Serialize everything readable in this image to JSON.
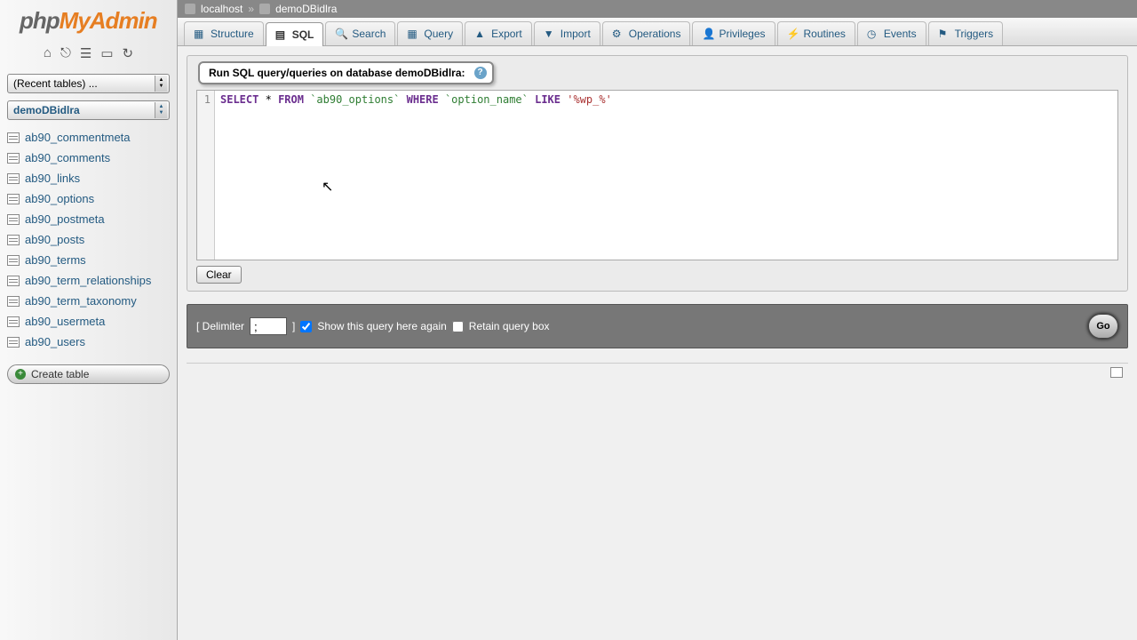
{
  "logo": {
    "part1": "php",
    "part2": "MyAdmin"
  },
  "breadcrumb": {
    "host": "localhost",
    "sep": "»",
    "db": "demoDBidlra"
  },
  "sidebar": {
    "recent_label": "(Recent tables) ...",
    "db_label": "demoDBidlra",
    "tables": [
      "ab90_commentmeta",
      "ab90_comments",
      "ab90_links",
      "ab90_options",
      "ab90_postmeta",
      "ab90_posts",
      "ab90_terms",
      "ab90_term_relationships",
      "ab90_term_taxonomy",
      "ab90_usermeta",
      "ab90_users"
    ],
    "create_label": "Create table"
  },
  "tabs": [
    "Structure",
    "SQL",
    "Search",
    "Query",
    "Export",
    "Import",
    "Operations",
    "Privileges",
    "Routines",
    "Events",
    "Triggers"
  ],
  "active_tab": 1,
  "panel": {
    "title_prefix": "Run SQL query/queries on database ",
    "title_db": "demoDBidlra",
    "title_suffix": ":"
  },
  "sql": {
    "line_no": "1",
    "kw_select": "SELECT",
    "star": "*",
    "kw_from": "FROM",
    "table": "`ab90_options`",
    "kw_where": "WHERE",
    "col": "`option_name`",
    "kw_like": "LIKE",
    "str": "'%wp_%'"
  },
  "clear_label": "Clear",
  "options": {
    "delimiter_label": "[ Delimiter",
    "delimiter_value": ";",
    "delimiter_close": "]",
    "show_again": "Show this query here again",
    "retain": "Retain query box",
    "go": "Go"
  }
}
